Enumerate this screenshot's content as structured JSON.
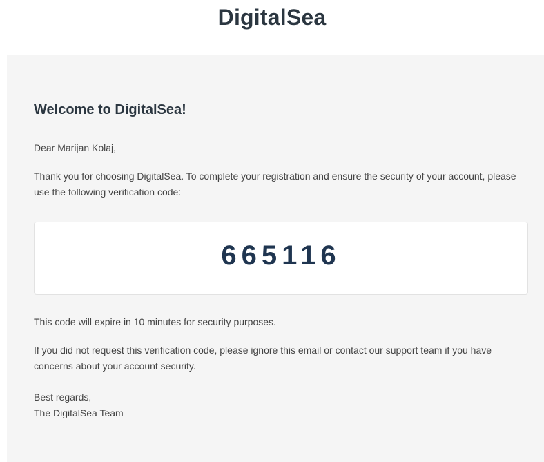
{
  "brand": {
    "title": "DigitalSea"
  },
  "email": {
    "heading": "Welcome to DigitalSea!",
    "greeting": "Dear Marijan Kolaj,",
    "intro": "Thank you for choosing DigitalSea. To complete your registration and ensure the security of your account, please use the following verification code:",
    "verification_code": "665116",
    "expiry_notice": "This code will expire in 10 minutes for security purposes.",
    "ignore_notice": "If you did not request this verification code, please ignore this email or contact our support team if you have concerns about your account security.",
    "sign_off": "Best regards,",
    "signature": "The DigitalSea Team"
  },
  "colors": {
    "panel_background": "#f5f5f5",
    "heading_text": "#2b3640",
    "code_text": "#1f3550"
  }
}
